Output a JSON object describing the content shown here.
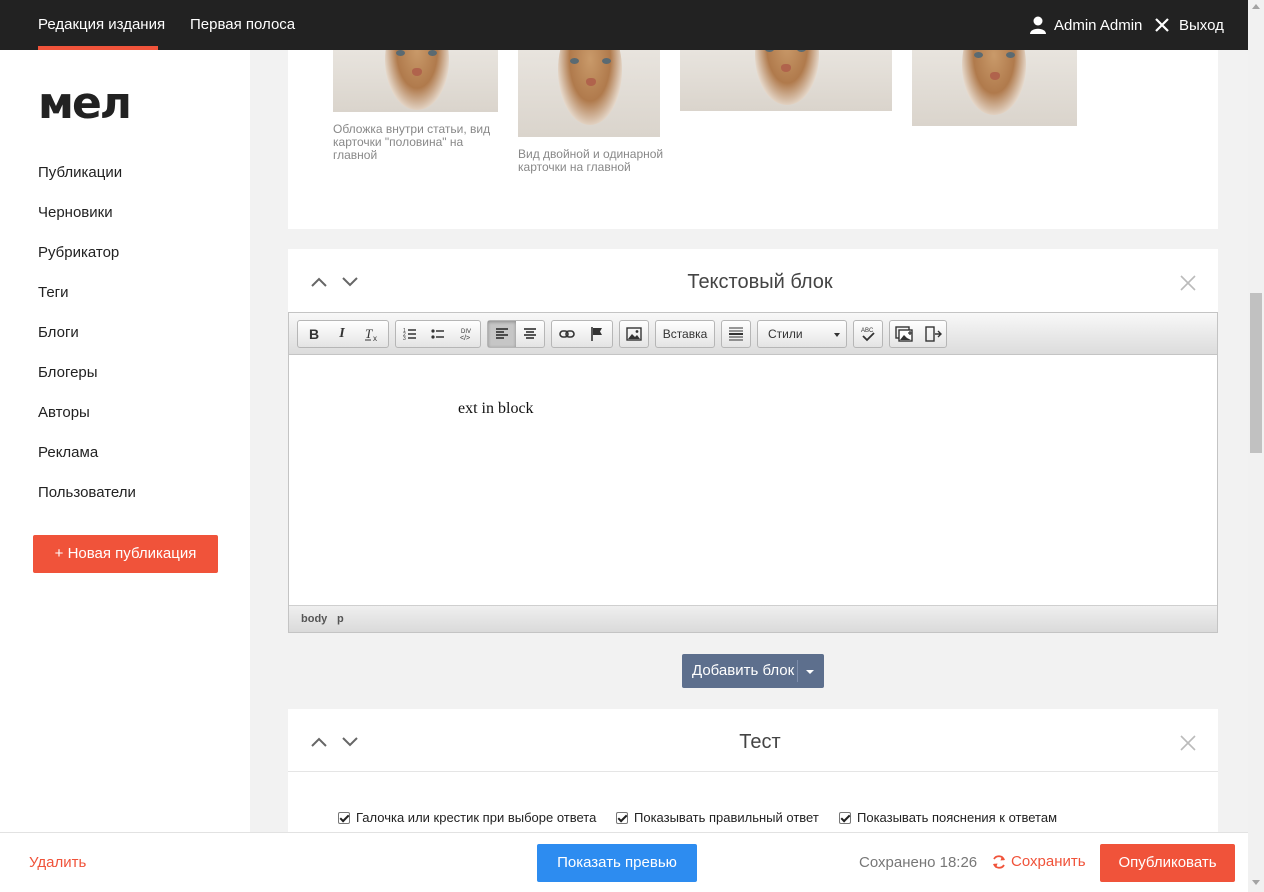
{
  "topbar": {
    "nav_edition": "Редакция издания",
    "nav_front": "Первая полоса",
    "user": "Admin Admin",
    "logout": "Выход"
  },
  "logo": "мел",
  "sidebar": {
    "items": [
      {
        "label": "Публикации"
      },
      {
        "label": "Черновики"
      },
      {
        "label": "Рубрикатор"
      },
      {
        "label": "Теги"
      },
      {
        "label": "Блоги"
      },
      {
        "label": "Блогеры"
      },
      {
        "label": "Авторы"
      },
      {
        "label": "Реклама"
      },
      {
        "label": "Пользователи"
      }
    ],
    "new_publication": "+ Новая публикация"
  },
  "images_card": {
    "captions": {
      "cover": "Обложка внутри статьи, вид карточки \"половина\" на главной",
      "double": "Вид двойной и одинарной карточки на главной"
    }
  },
  "text_block": {
    "title": "Текстовый блок",
    "toolbar": {
      "insert_label": "Вставка",
      "styles_label": "Стили"
    },
    "content": "ext in block",
    "path": [
      "body",
      "p"
    ]
  },
  "add_block": {
    "label": "Добавить блок"
  },
  "test_block": {
    "title": "Тест",
    "options": [
      {
        "label": "Галочка или крестик при выборе ответа",
        "checked": true
      },
      {
        "label": "Показывать правильный ответ",
        "checked": true
      },
      {
        "label": "Показывать пояснения к ответам",
        "checked": true
      }
    ]
  },
  "bottombar": {
    "delete": "Удалить",
    "preview": "Показать превью",
    "saved": "Сохранено 18:26",
    "save": "Сохранить",
    "publish": "Опубликовать"
  },
  "colors": {
    "accent": "#f0533a",
    "preview": "#2d8cf0",
    "add_block": "#5d6f8d",
    "topbar": "#222222"
  }
}
